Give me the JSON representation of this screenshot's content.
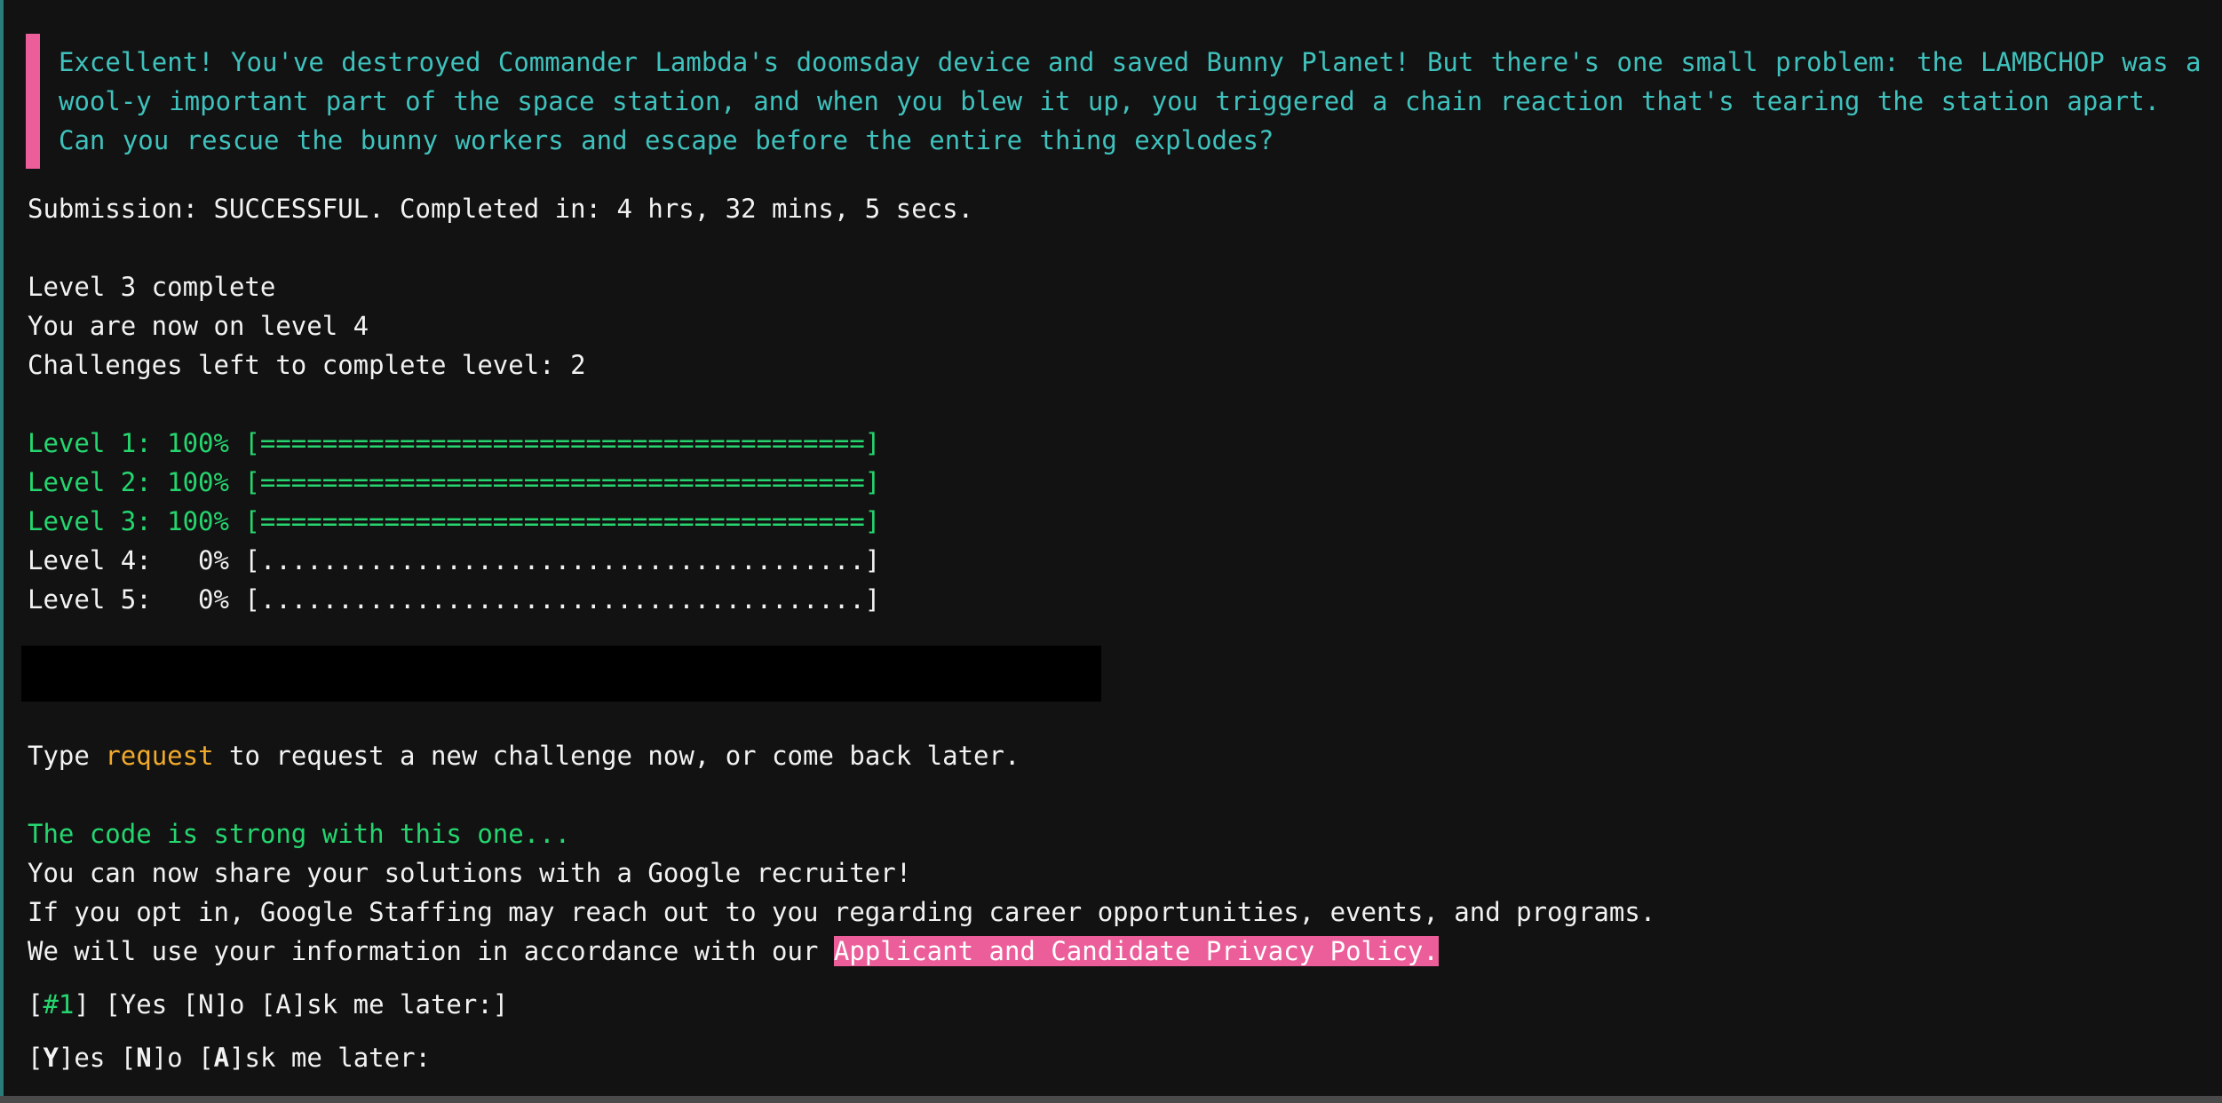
{
  "story": "Excellent! You've destroyed Commander Lambda's doomsday device and saved Bunny Planet! But there's one small problem: the LAMBCHOP was a wool-y important part of the space station, and when you blew it up, you triggered a chain reaction that's tearing the station apart. Can you rescue the bunny workers and escape before the entire thing explodes?",
  "submission": "Submission: SUCCESSFUL. Completed in: 4 hrs, 32 mins, 5 secs.",
  "status": {
    "level_complete": "Level 3 complete",
    "current_level": "You are now on level 4",
    "challenges_left": "Challenges left to complete level: 2"
  },
  "progress": [
    {
      "label": "Level 1: 100% [=======================================]",
      "percent": 100
    },
    {
      "label": "Level 2: 100% [=======================================]",
      "percent": 100
    },
    {
      "label": "Level 3: 100% [=======================================]",
      "percent": 100
    },
    {
      "label": "Level 4:   0% [.......................................]",
      "percent": 0
    },
    {
      "label": "Level 5:   0% [.......................................]",
      "percent": 0
    }
  ],
  "prompt": {
    "before": "Type ",
    "keyword": "request",
    "after": " to request a new challenge now, or come back later."
  },
  "recruit": {
    "tagline": "The code is strong with this one...",
    "share": "You can now share your solutions with a Google recruiter!",
    "optin": "If you opt in, Google Staffing may reach out to you regarding career opportunities, events, and programs.",
    "policy_prefix": "We will use your information in accordance with our ",
    "policy_link": "Applicant and Candidate Privacy Policy."
  },
  "question": {
    "open": "[",
    "id": "#1",
    "rest": "] [Yes [N]o [A]sk me later:]"
  },
  "answer_prompt": {
    "b1": "[",
    "k1": "Y",
    "t1": "]es [",
    "k2": "N",
    "t2": "]o [",
    "k3": "A",
    "t3": "]sk me later:"
  },
  "colors": {
    "background": "#121212",
    "story_text": "#3fc2bd",
    "accent_pink": "#ec5e9a",
    "complete_green": "#25d66f",
    "keyword_orange": "#f2aa2a"
  }
}
